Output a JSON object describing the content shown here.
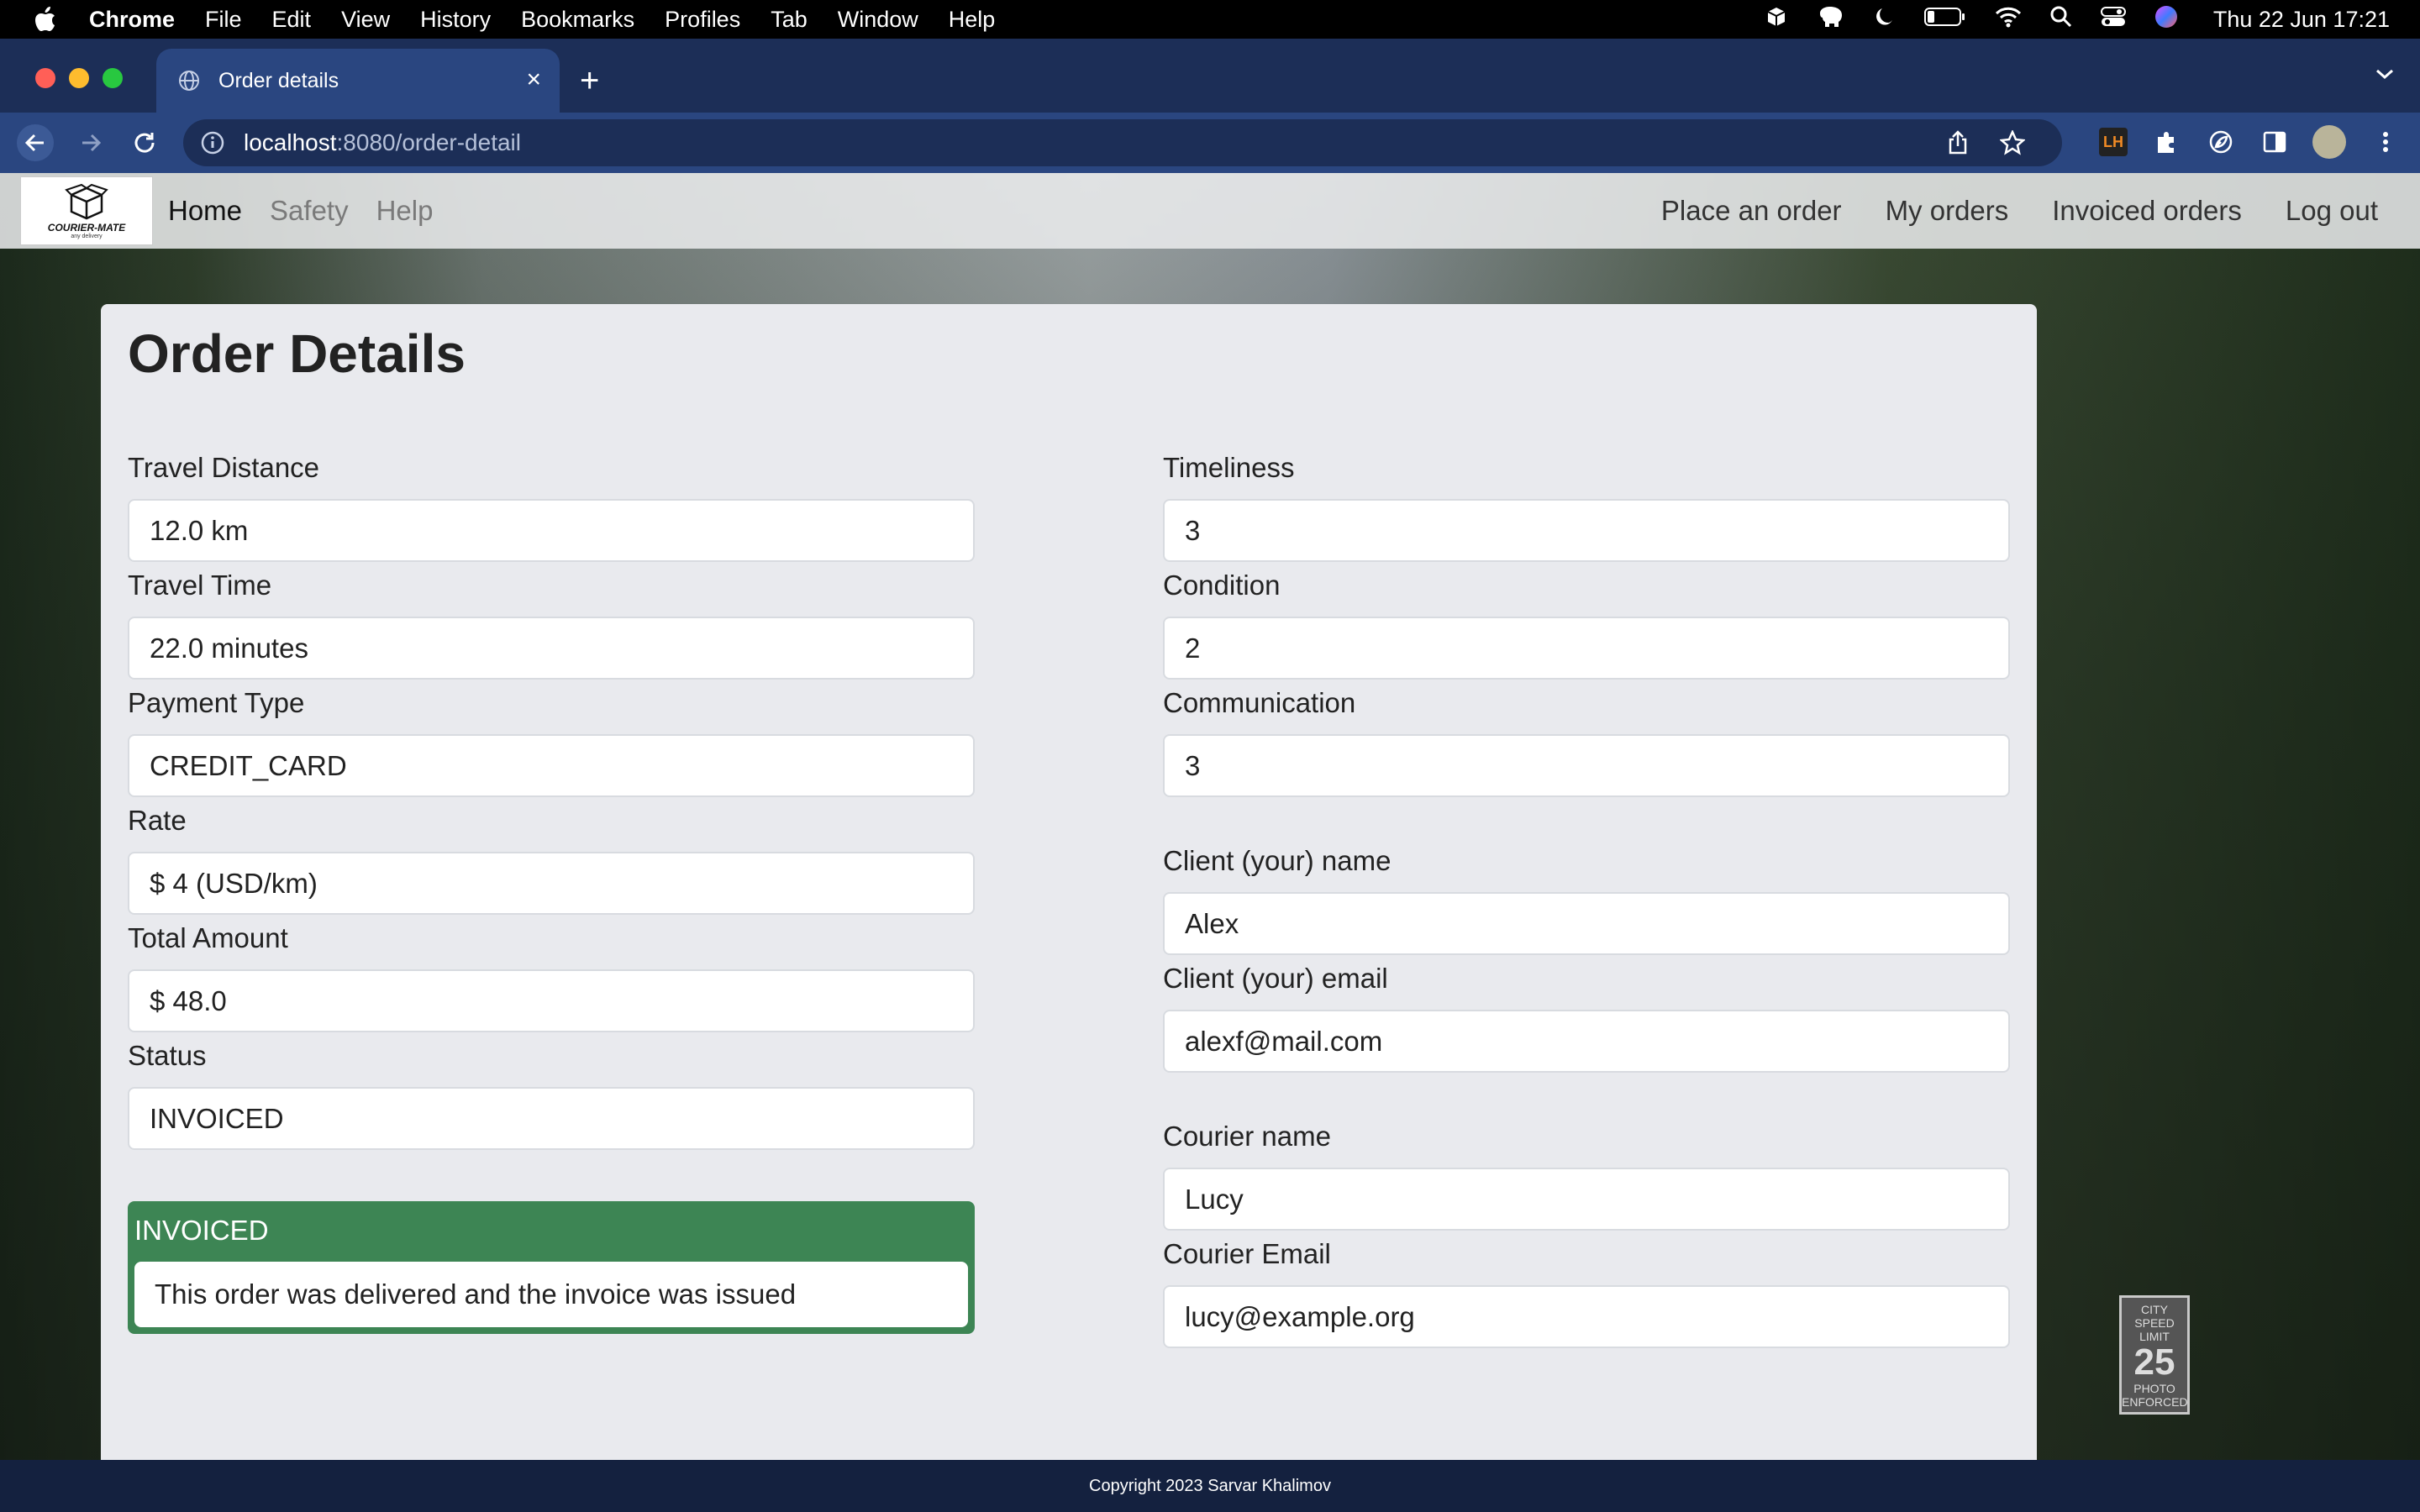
{
  "menubar": {
    "app": "Chrome",
    "items": [
      "File",
      "Edit",
      "View",
      "History",
      "Bookmarks",
      "Profiles",
      "Tab",
      "Window",
      "Help"
    ],
    "clock": "Thu 22 Jun  17:21"
  },
  "browser": {
    "tab_title": "Order details",
    "url_host": "localhost",
    "url_path": ":8080/order-detail",
    "extension_label": "LH"
  },
  "site": {
    "brand_name": "COURIER-MATE",
    "brand_tagline": "any delivery",
    "nav_left": [
      "Home",
      "Safety",
      "Help"
    ],
    "nav_right": [
      "Place an order",
      "My orders",
      "Invoiced orders",
      "Log out"
    ]
  },
  "order": {
    "heading": "Order Details",
    "left_fields": [
      {
        "label": "Travel Distance",
        "value": "12.0 km"
      },
      {
        "label": "Travel Time",
        "value": "22.0 minutes"
      },
      {
        "label": "Payment Type",
        "value": "CREDIT_CARD"
      },
      {
        "label": "Rate",
        "value": "$ 4 (USD/km)"
      },
      {
        "label": "Total Amount",
        "value": "$ 48.0"
      },
      {
        "label": "Status",
        "value": "INVOICED"
      }
    ],
    "right_fields": [
      {
        "label": "Timeliness",
        "value": "3"
      },
      {
        "label": "Condition",
        "value": "2"
      },
      {
        "label": "Communication",
        "value": "3"
      },
      {
        "label": "Client (your) name",
        "value": "Alex"
      },
      {
        "label": "Client (your) email",
        "value": "alexf@mail.com"
      },
      {
        "label": "Courier name",
        "value": "Lucy"
      },
      {
        "label": "Courier Email",
        "value": "lucy@example.org"
      }
    ],
    "status_panel": {
      "title": "INVOICED",
      "message": "This order was delivered and the invoice was issued",
      "color": "#3d8554"
    }
  },
  "background_sign": {
    "top": "CITY SPEED LIMIT",
    "number": "25",
    "bottom": "PHOTO ENFORCED"
  },
  "footer": {
    "text": "Copyright 2023 Sarvar Khalimov"
  }
}
